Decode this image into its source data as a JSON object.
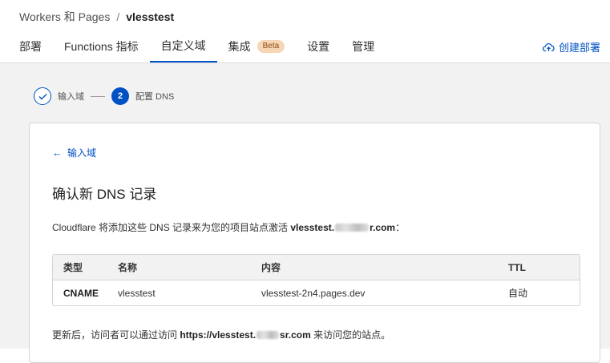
{
  "breadcrumb": {
    "parent": "Workers 和 Pages",
    "separator": "/",
    "current": "vlesstest"
  },
  "tabs": [
    {
      "label": "部署"
    },
    {
      "label": "Functions 指标"
    },
    {
      "label": "自定义域",
      "active": true
    },
    {
      "label": "集成",
      "badge": "Beta"
    },
    {
      "label": "设置"
    },
    {
      "label": "管理"
    }
  ],
  "header_action": {
    "label": "创建部署",
    "icon": "cloud-upload-icon"
  },
  "stepper": {
    "steps": [
      {
        "label": "输入域",
        "status": "done",
        "icon": "check-icon"
      },
      {
        "number": "2",
        "label": "配置 DNS",
        "status": "current"
      }
    ]
  },
  "card": {
    "back_label": "输入域",
    "title": "确认新 DNS 记录",
    "desc_prefix": "Cloudflare 将添加这些 DNS 记录来为您的项目站点激活 ",
    "desc_domain_start": "vlesstest.",
    "desc_domain_end": "r.com",
    "desc_suffix": "：",
    "table": {
      "headers": [
        "类型",
        "名称",
        "内容",
        "TTL"
      ],
      "rows": [
        [
          "CNAME",
          "vlesstest",
          "vlesstest-2n4.pages.dev",
          "自动"
        ]
      ]
    },
    "note_prefix": "更新后，访问者可以通过访问 ",
    "note_domain_start": "https://vlesstest.",
    "note_domain_end": "sr.com",
    "note_suffix": " 来访问您的站点。"
  },
  "colors": {
    "accent": "#0051c3",
    "beta_bg": "#f6d6b5",
    "page_bg": "#f2f2f2"
  }
}
